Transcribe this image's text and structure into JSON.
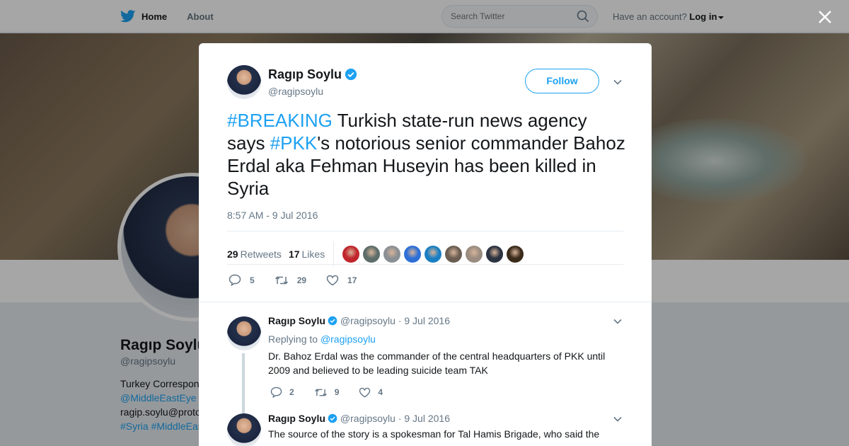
{
  "topbar": {
    "home_label": "Home",
    "about_label": "About",
    "search_placeholder": "Search Twitter",
    "account_prompt": "Have an account?",
    "login_label": "Log in"
  },
  "background_profile": {
    "name": "Ragıp Soylu",
    "handle": "@ragipsoylu",
    "bio_line1": "Turkey Correspon",
    "bio_link": "@MiddleEastEye",
    "email_line": "ragip.soylu@proto",
    "hashtags_line": "#Syria #MiddleEas"
  },
  "tweet": {
    "author_name": "Ragıp Soylu",
    "author_handle": "@ragipsoylu",
    "follow_label": "Follow",
    "text_parts": {
      "hashtag1": "#BREAKING",
      "part1": " Turkish state-run news agency says ",
      "hashtag2": "#PKK",
      "part2": "'s notorious senior commander Bahoz Erdal aka Fehman Huseyin has been killed in Syria"
    },
    "timestamp": "8:57 AM - 9 Jul 2016",
    "retweets_count": "29",
    "retweets_label": "Retweets",
    "likes_count": "17",
    "likes_label": "Likes",
    "liker_avatar_colors": [
      "#c0262b",
      "#5d6d6a",
      "#8a8f94",
      "#2d6fd6",
      "#1a7fc2",
      "#6a5e52",
      "#9a8c80",
      "#2b3240",
      "#3a2a1a"
    ],
    "reply_count": "5",
    "retweet_count": "29",
    "like_count": "17"
  },
  "replies": [
    {
      "author_name": "Ragıp Soylu",
      "author_handle": "@ragipsoylu",
      "date": "· 9 Jul 2016",
      "replying_prefix": "Replying to",
      "replying_handle": "@ragipsoylu",
      "text": "Dr. Bahoz Erdal was the commander of the central headquarters of PKK until 2009 and believed to be leading   suicide team TAK",
      "reply_count": "2",
      "retweet_count": "9",
      "like_count": "4"
    },
    {
      "author_name": "Ragıp Soylu",
      "author_handle": "@ragipsoylu",
      "date": "· 9 Jul 2016",
      "text": "The source of the story is a spokesman for Tal Hamis Brigade, who said the"
    }
  ],
  "colors": {
    "accent": "#1da1f2",
    "text": "#14171a",
    "muted": "#657786"
  }
}
